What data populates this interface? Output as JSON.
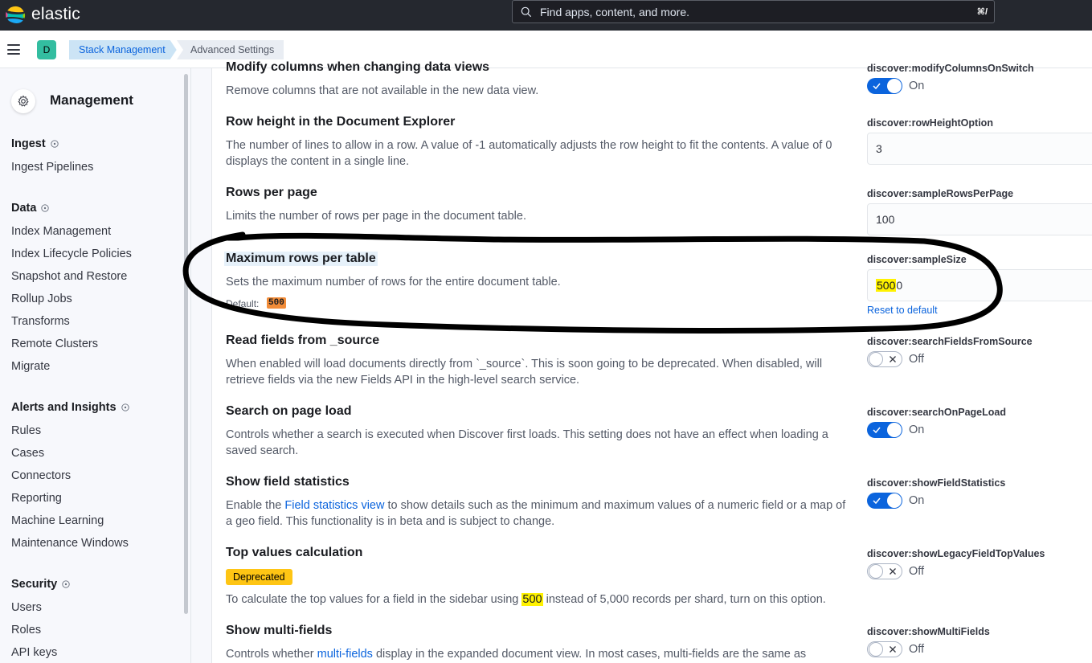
{
  "header": {
    "logo_text": "elastic",
    "search_placeholder": "Find apps, content, and more.",
    "search_shortcut": "⌘/"
  },
  "subbar": {
    "space_initial": "D",
    "breadcrumbs": [
      "Stack Management",
      "Advanced Settings"
    ]
  },
  "sidebar": {
    "title": "Management",
    "sections": [
      {
        "heading": "Ingest",
        "items": [
          "Ingest Pipelines"
        ]
      },
      {
        "heading": "Data",
        "items": [
          "Index Management",
          "Index Lifecycle Policies",
          "Snapshot and Restore",
          "Rollup Jobs",
          "Transforms",
          "Remote Clusters",
          "Migrate"
        ]
      },
      {
        "heading": "Alerts and Insights",
        "items": [
          "Rules",
          "Cases",
          "Connectors",
          "Reporting",
          "Machine Learning",
          "Maintenance Windows"
        ]
      },
      {
        "heading": "Security",
        "items": [
          "Users",
          "Roles",
          "API keys"
        ]
      }
    ]
  },
  "settings": {
    "modify_columns": {
      "title": "Modify columns when changing data views",
      "desc": "Remove columns that are not available in the new data view.",
      "key": "discover:modifyColumnsOnSwitch",
      "state": "On"
    },
    "row_height": {
      "title": "Row height in the Document Explorer",
      "desc": "The number of lines to allow in a row. A value of -1 automatically adjusts the row height to fit the contents. A value of 0 displays the content in a single line.",
      "key": "discover:rowHeightOption",
      "value": "3"
    },
    "rows_per_page": {
      "title": "Rows per page",
      "desc": "Limits the number of rows per page in the document table.",
      "key": "discover:sampleRowsPerPage",
      "value": "100"
    },
    "max_rows": {
      "title": "Maximum rows per table",
      "desc": "Sets the maximum number of rows for the entire document table.",
      "default_label": "Default:",
      "default_value": "500",
      "key": "discover:sampleSize",
      "value_highlight": "500",
      "value_rest": "0",
      "reset": "Reset to default"
    },
    "read_source": {
      "title": "Read fields from _source",
      "desc": "When enabled will load documents directly from `_source`. This is soon going to be deprecated. When disabled, will retrieve fields via the new Fields API in the high-level search service.",
      "key": "discover:searchFieldsFromSource",
      "state": "Off"
    },
    "search_on_load": {
      "title": "Search on page load",
      "desc": "Controls whether a search is executed when Discover first loads. This setting does not have an effect when loading a saved search.",
      "key": "discover:searchOnPageLoad",
      "state": "On"
    },
    "field_stats": {
      "title": "Show field statistics",
      "desc_pre": "Enable the ",
      "link": "Field statistics view",
      "desc_post": " to show details such as the minimum and maximum values of a numeric field or a map of a geo field. This functionality is in beta and is subject to change.",
      "key": "discover:showFieldStatistics",
      "state": "On"
    },
    "top_values": {
      "title": "Top values calculation",
      "badge": "Deprecated",
      "desc_pre": "To calculate the top values for a field in the sidebar using ",
      "highlight": "500",
      "desc_post": " instead of 5,000 records per shard, turn on this option.",
      "key": "discover:showLegacyFieldTopValues",
      "state": "Off"
    },
    "multi_fields": {
      "title": "Show multi-fields",
      "desc_pre": "Controls whether ",
      "link": "multi-fields",
      "desc_post": " display in the expanded document view. In most cases, multi-fields are the same as",
      "key": "discover:showMultiFields",
      "state": "Off"
    }
  }
}
